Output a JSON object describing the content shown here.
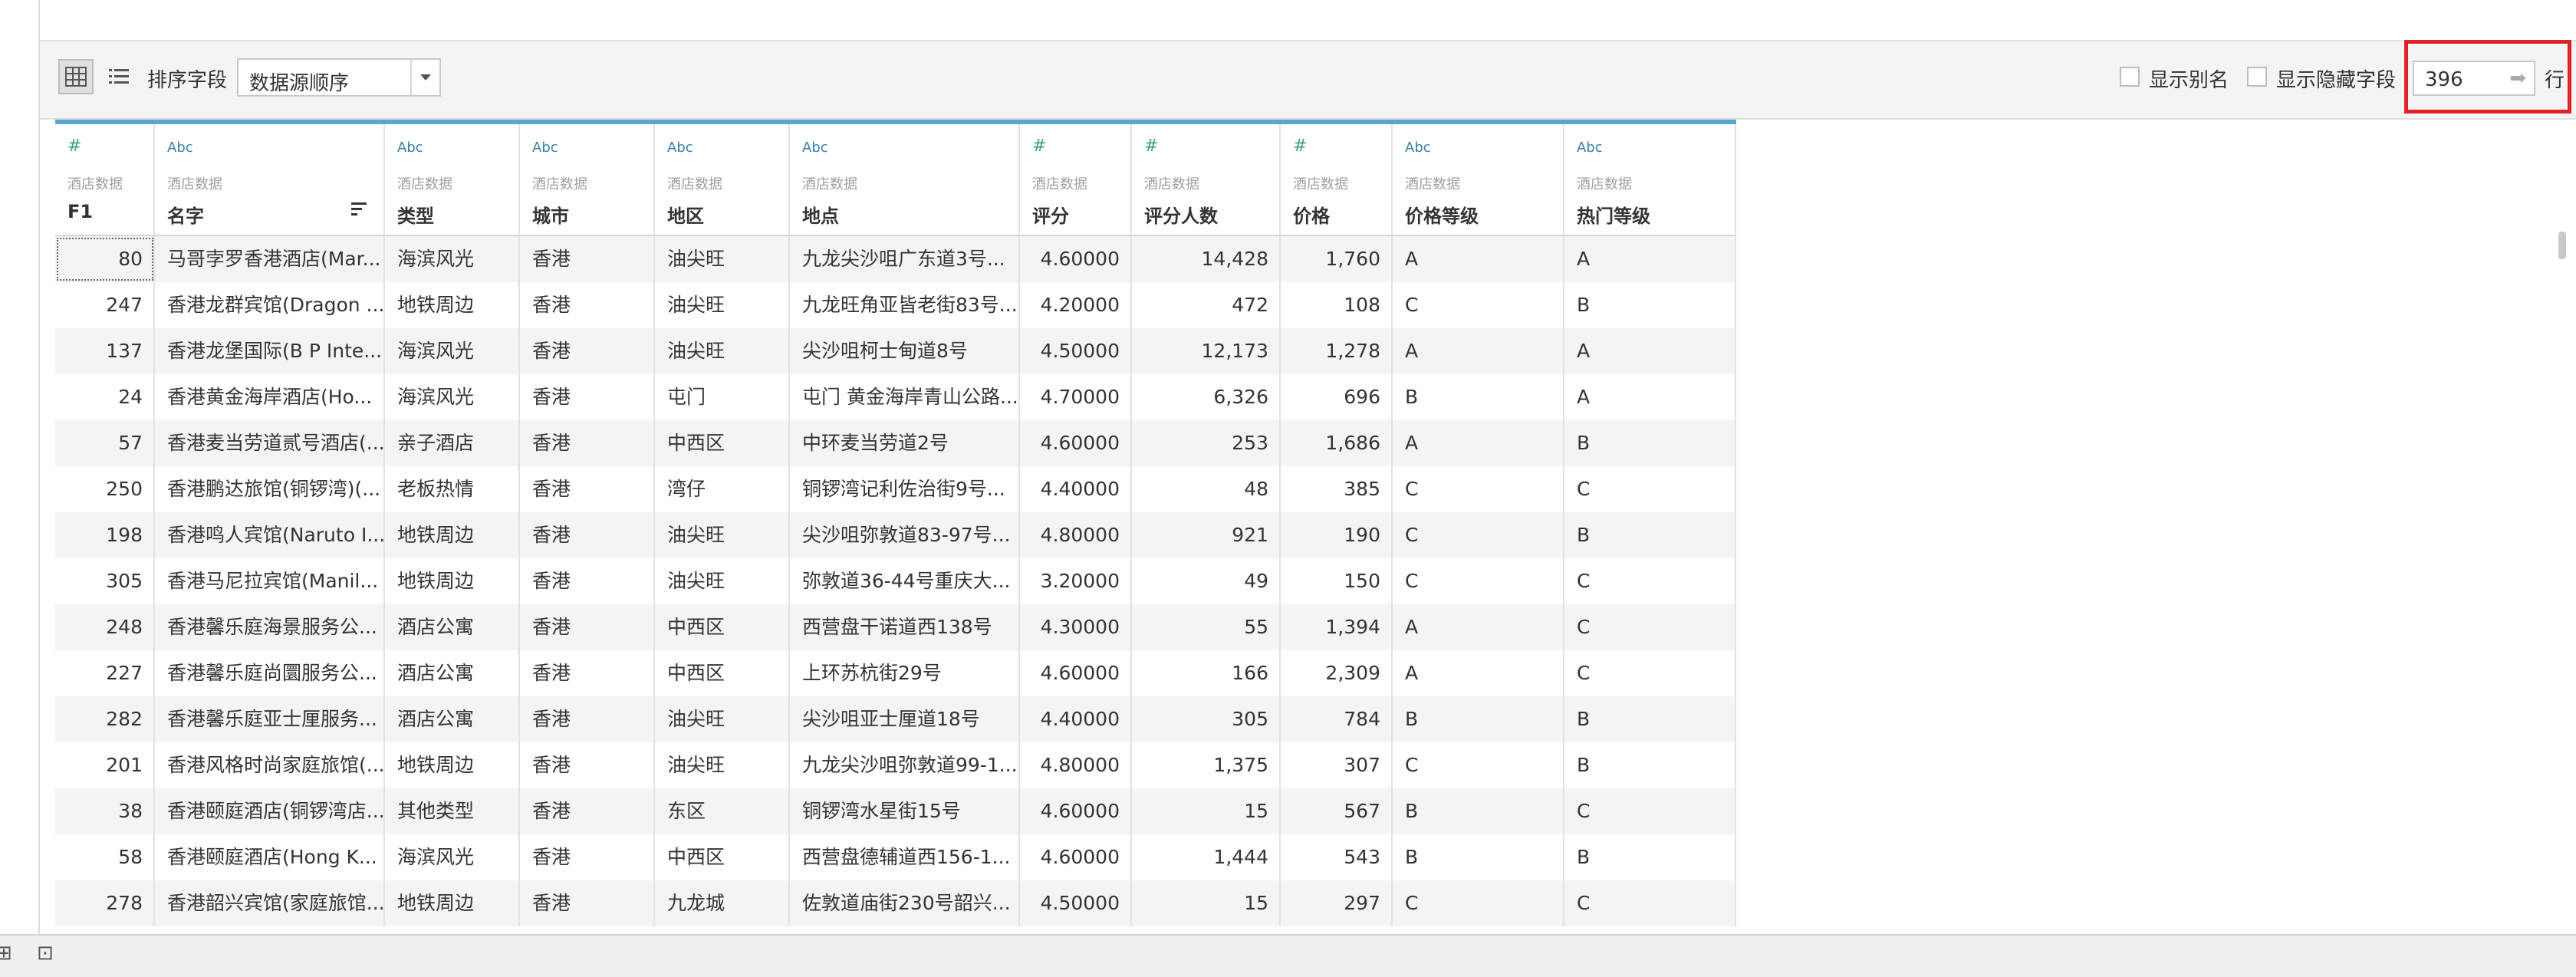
{
  "toolbar": {
    "sort_label": "排序字段",
    "sort_value": "数据源顺序",
    "show_alias_label": "显示别名",
    "show_hidden_label": "显示隐藏字段",
    "rows_value": "396",
    "rows_unit": "行"
  },
  "table": {
    "columns": [
      {
        "type": "#",
        "source": "酒店数据",
        "name": "F1"
      },
      {
        "type": "Abc",
        "source": "酒店数据",
        "name": "名字"
      },
      {
        "type": "Abc",
        "source": "酒店数据",
        "name": "类型"
      },
      {
        "type": "Abc",
        "source": "酒店数据",
        "name": "城市"
      },
      {
        "type": "Abc",
        "source": "酒店数据",
        "name": "地区"
      },
      {
        "type": "Abc",
        "source": "酒店数据",
        "name": "地点"
      },
      {
        "type": "#",
        "source": "酒店数据",
        "name": "评分"
      },
      {
        "type": "#",
        "source": "酒店数据",
        "name": "评分人数"
      },
      {
        "type": "#",
        "source": "酒店数据",
        "name": "价格"
      },
      {
        "type": "Abc",
        "source": "酒店数据",
        "name": "价格等级"
      },
      {
        "type": "Abc",
        "source": "酒店数据",
        "name": "热门等级"
      }
    ],
    "rows": [
      [
        "80",
        "马哥孛罗香港酒店(Mar...",
        "海滨风光",
        "香港",
        "油尖旺",
        "九龙尖沙咀广东道3号...",
        "4.60000",
        "14,428",
        "1,760",
        "A",
        "A"
      ],
      [
        "247",
        "香港龙群宾馆(Dragon ...",
        "地铁周边",
        "香港",
        "油尖旺",
        "九龙旺角亚皆老街83号...",
        "4.20000",
        "472",
        "108",
        "C",
        "B"
      ],
      [
        "137",
        "香港龙堡国际(B P Inte...",
        "海滨风光",
        "香港",
        "油尖旺",
        "尖沙咀柯士甸道8号",
        "4.50000",
        "12,173",
        "1,278",
        "A",
        "A"
      ],
      [
        "24",
        "香港黄金海岸酒店(Ho...",
        "海滨风光",
        "香港",
        "屯门",
        "屯门 黄金海岸青山公路...",
        "4.70000",
        "6,326",
        "696",
        "B",
        "A"
      ],
      [
        "57",
        "香港麦当劳道贰号酒店(...",
        "亲子酒店",
        "香港",
        "中西区",
        "中环麦当劳道2号",
        "4.60000",
        "253",
        "1,686",
        "A",
        "B"
      ],
      [
        "250",
        "香港鹏达旅馆(铜锣湾)(...",
        "老板热情",
        "香港",
        "湾仔",
        "铜锣湾记利佐治街9号...",
        "4.40000",
        "48",
        "385",
        "C",
        "C"
      ],
      [
        "198",
        "香港鸣人宾馆(Naruto I...",
        "地铁周边",
        "香港",
        "油尖旺",
        "尖沙咀弥敦道83-97号...",
        "4.80000",
        "921",
        "190",
        "C",
        "B"
      ],
      [
        "305",
        "香港马尼拉宾馆(Manil...",
        "地铁周边",
        "香港",
        "油尖旺",
        "弥敦道36-44号重庆大...",
        "3.20000",
        "49",
        "150",
        "C",
        "C"
      ],
      [
        "248",
        "香港馨乐庭海景服务公...",
        "酒店公寓",
        "香港",
        "中西区",
        "西营盘干诺道西138号",
        "4.30000",
        "55",
        "1,394",
        "A",
        "C"
      ],
      [
        "227",
        "香港馨乐庭尚圜服务公...",
        "酒店公寓",
        "香港",
        "中西区",
        "上环苏杭街29号",
        "4.60000",
        "166",
        "2,309",
        "A",
        "C"
      ],
      [
        "282",
        "香港馨乐庭亚士厘服务...",
        "酒店公寓",
        "香港",
        "油尖旺",
        "尖沙咀亚士厘道18号",
        "4.40000",
        "305",
        "784",
        "B",
        "B"
      ],
      [
        "201",
        "香港风格时尚家庭旅馆(...",
        "地铁周边",
        "香港",
        "油尖旺",
        "九龙尖沙咀弥敦道99-1...",
        "4.80000",
        "1,375",
        "307",
        "C",
        "B"
      ],
      [
        "38",
        "香港颐庭酒店(铜锣湾店...",
        "其他类型",
        "香港",
        "东区",
        "铜锣湾水星街15号",
        "4.60000",
        "15",
        "567",
        "B",
        "C"
      ],
      [
        "58",
        "香港颐庭酒店(Hong K...",
        "海滨风光",
        "香港",
        "中西区",
        "西营盘德辅道西156-1...",
        "4.60000",
        "1,444",
        "543",
        "B",
        "B"
      ],
      [
        "278",
        "香港韶兴宾馆(家庭旅馆...",
        "地铁周边",
        "香港",
        "九龙城",
        "佐敦道庙街230号韶兴...",
        "4.50000",
        "15",
        "297",
        "C",
        "C"
      ]
    ]
  },
  "colors": {
    "accent": "#5aa6cc",
    "highlight": "#e12222"
  },
  "icons": [
    "grid-view-icon",
    "list-view-icon",
    "sort-icon",
    "number-type-icon",
    "add-sheet-icon"
  ]
}
